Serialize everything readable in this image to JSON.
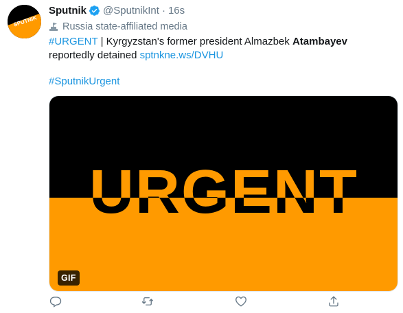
{
  "tweet": {
    "author_name": "Sputnik",
    "handle": "@SputnikInt",
    "separator": "·",
    "time": "16s",
    "label": "Russia state-affiliated media",
    "avatar_text": "SPUTNIK",
    "text": {
      "hashtag": "#URGENT",
      "sep": " | ",
      "body": "Kyrgyzstan's former president Almazbek ",
      "bold": "Atambayev",
      "body2": " reportedly detained ",
      "link": "sptnkne.ws/DVHU"
    },
    "hashtag2": "#SputnikUrgent",
    "media": {
      "headline": "URGENT",
      "badge": "GIF",
      "top_color": "#000000",
      "bottom_color": "#ff9a00"
    }
  },
  "colors": {
    "text": "#14171a",
    "secondary": "#657786",
    "link": "#1b95e0",
    "verified": "#1da1f2"
  },
  "icons": [
    "verified-badge-icon",
    "state-media-flag-icon",
    "reply-icon",
    "retweet-icon",
    "like-icon",
    "share-icon"
  ]
}
